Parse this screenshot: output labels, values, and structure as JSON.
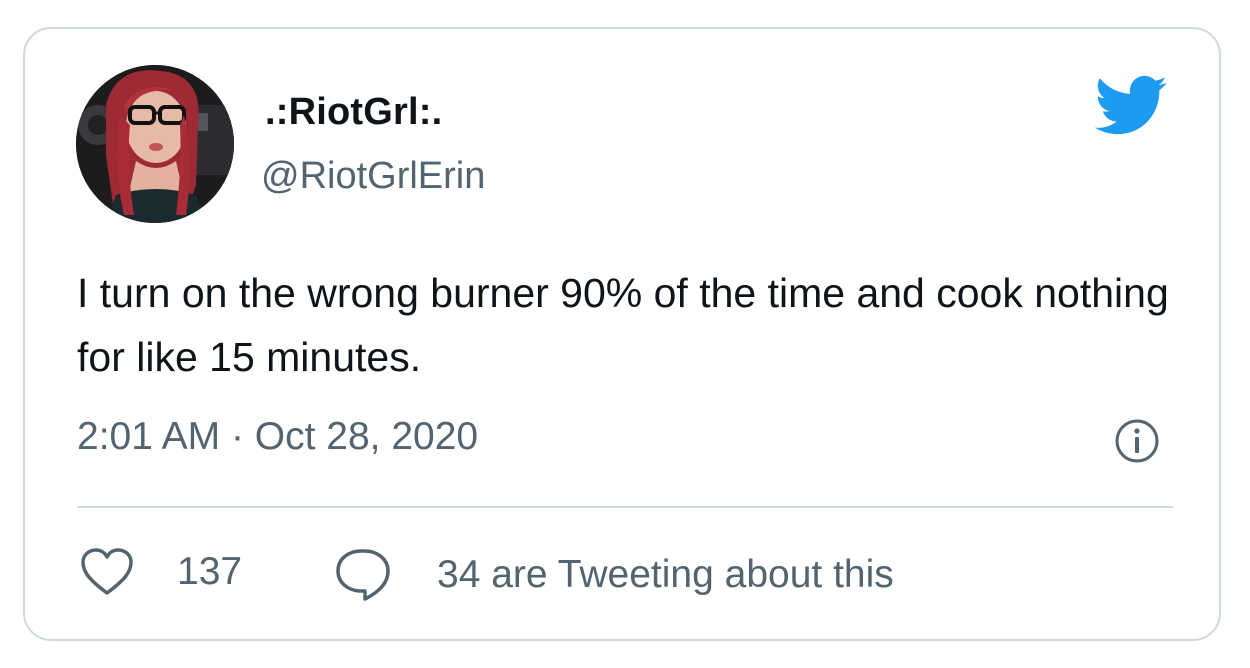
{
  "tweet": {
    "display_name": ".:RiotGrl:.",
    "handle": "@RiotGrlErin",
    "text": "I turn on the wrong burner 90% of the time and cook nothing for like 15 minutes.",
    "time": "2:01 AM",
    "separator": "·",
    "date": "Oct 28, 2020",
    "likes_count": "137",
    "conversation_label": "34 are Tweeting about this"
  },
  "icons": {
    "brand": "twitter-bird-icon",
    "info": "info-icon",
    "like": "heart-icon",
    "reply": "speech-bubble-icon"
  },
  "colors": {
    "twitter_blue": "#1d9bf0",
    "text_primary": "#0f1419",
    "text_secondary": "#536471",
    "border": "#cfd9de"
  }
}
